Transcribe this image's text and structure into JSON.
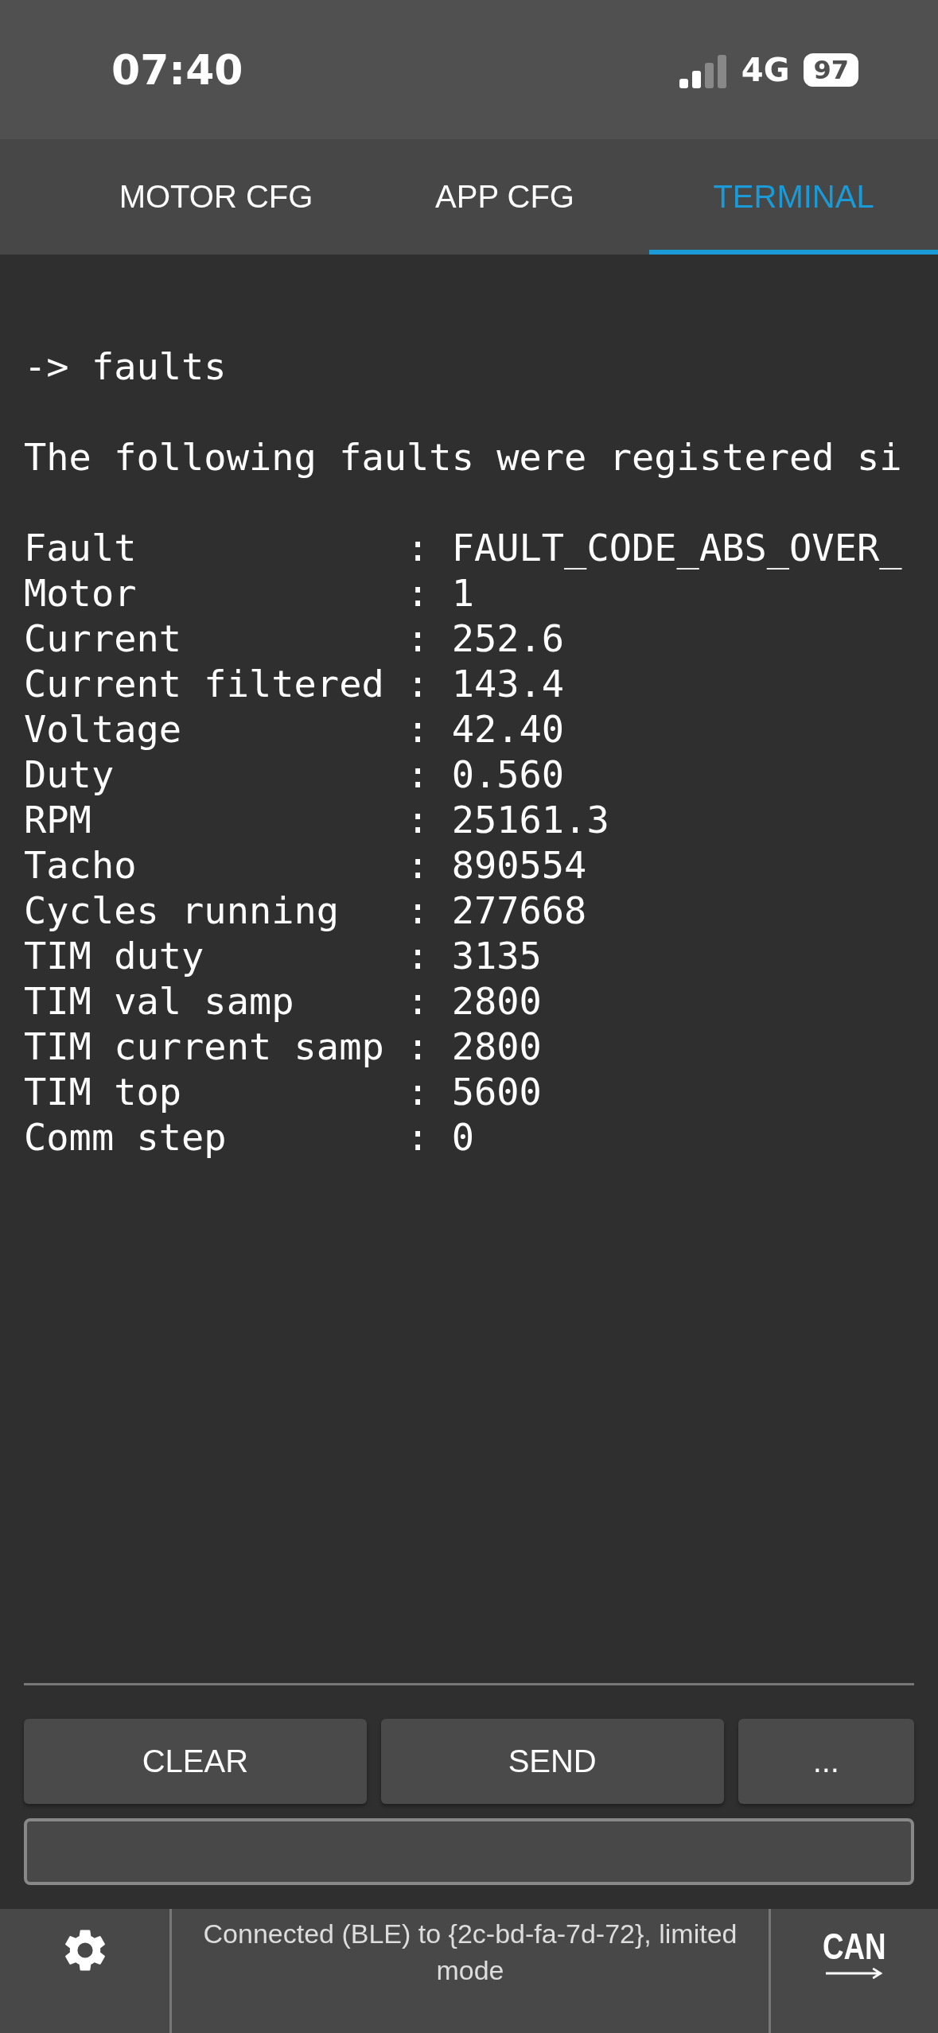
{
  "status_bar": {
    "time": "07:40",
    "network": "4G",
    "battery": "97"
  },
  "tabs": [
    {
      "label": "MOTOR CFG",
      "selected": false
    },
    {
      "label": "APP CFG",
      "selected": false
    },
    {
      "label": "TERMINAL",
      "selected": true
    }
  ],
  "terminal": {
    "command": "-> faults",
    "message": "The following faults were registered si",
    "lines": [
      "Fault            : FAULT_CODE_ABS_OVER_",
      "Motor            : 1",
      "Current          : 252.6",
      "Current filtered : 143.4",
      "Voltage          : 42.40",
      "Duty             : 0.560",
      "RPM              : 25161.3",
      "Tacho            : 890554",
      "Cycles running   : 277668",
      "TIM duty         : 3135",
      "TIM val samp     : 2800",
      "TIM current samp : 2800",
      "TIM top          : 5600",
      "Comm step        : 0"
    ]
  },
  "buttons": [
    "CLEAR",
    "SEND",
    "..."
  ],
  "bottom_bar": {
    "status": "Connected (BLE) to {2c-bd-fa-7d-72}, limited mode",
    "can_label": "CAN"
  }
}
